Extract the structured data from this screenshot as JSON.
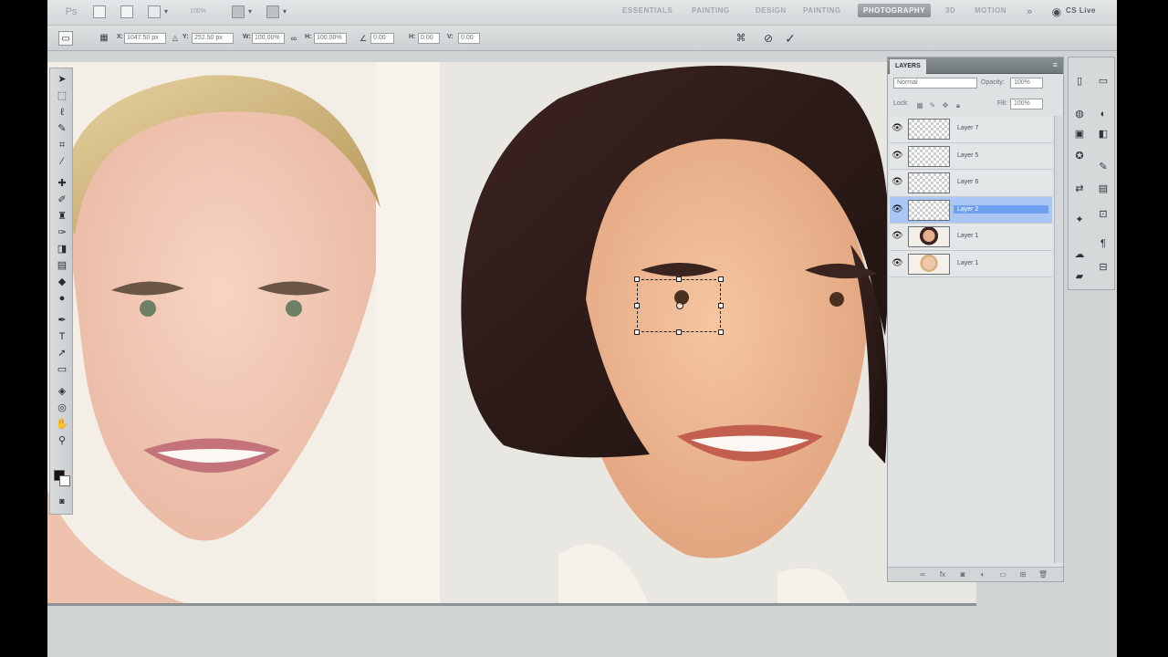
{
  "app": {
    "title": "Adobe Photoshop CS5",
    "cs_live": "CS Live"
  },
  "appbar": {
    "icons": [
      "ps-logo",
      "bridge-icon",
      "mini-bridge-icon",
      "arrange-icon",
      "zoom-level",
      "screen-mode-icon",
      "extras-icon"
    ],
    "zoom_label": "100%",
    "workspaces": [
      "ESSENTIALS",
      "PAINTING",
      "DESIGN",
      "PAINTING",
      "PHOTOGRAPHY",
      "3D",
      "MOTION"
    ],
    "active_workspace": "PHOTOGRAPHY"
  },
  "optbar": {
    "x": "1047.50 px",
    "y": "252.50 px",
    "w": "100.00%",
    "h": "100.00%",
    "angle": "0.00",
    "h_skew": "0.00",
    "v_skew": "0.00",
    "x_label": "X:",
    "y_label": "Y:",
    "w_label": "W:",
    "h_label": "H:",
    "h_skew_label": "H:",
    "v_skew_label": "V:"
  },
  "layers_panel": {
    "tab": "LAYERS",
    "blend_mode": "Normal",
    "opacity_label": "Opacity:",
    "opacity": "100%",
    "lock_label": "Lock:",
    "fill_label": "Fill:",
    "fill": "100%",
    "layers": [
      {
        "name": "Layer 7",
        "thumb": "transparent",
        "selected": false
      },
      {
        "name": "Layer 5",
        "thumb": "transparent",
        "selected": false
      },
      {
        "name": "Layer 6",
        "thumb": "transparent",
        "selected": false
      },
      {
        "name": "Layer 2",
        "thumb": "transparent",
        "selected": true
      },
      {
        "name": "Layer 1",
        "thumb": "photo-b",
        "selected": false
      },
      {
        "name": "Layer 1",
        "thumb": "photo-a",
        "selected": false
      }
    ]
  },
  "colors": {
    "selection": "#6f9ff0",
    "workspace_active": "#8a9194",
    "canvas_bg": "#cfd3d4"
  }
}
